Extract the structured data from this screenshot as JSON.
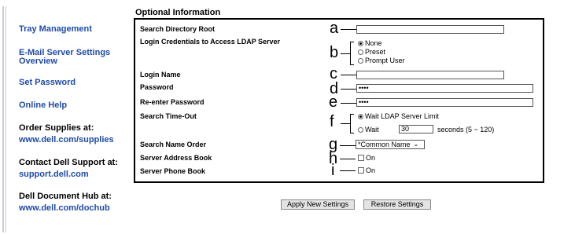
{
  "sidebar": {
    "links": [
      {
        "label": "Tray Management"
      },
      {
        "label": "E-Mail Server Settings Overview"
      },
      {
        "label": "Set Password"
      },
      {
        "label": "Online Help"
      }
    ],
    "order_title": "Order Supplies at:",
    "order_url": "www.dell.com/supplies",
    "support_title": "Contact Dell Support at:",
    "support_url": "support.dell.com",
    "hub_title": "Dell Document Hub at:",
    "hub_url": "www.dell.com/dochub"
  },
  "form": {
    "section_title": "Optional Information",
    "rows": {
      "search_root": "Search Directory Root",
      "login_credentials": "Login Credentials to Access LDAP Server",
      "login_name": "Login Name",
      "password": "Password",
      "reenter_password": "Re-enter Password",
      "timeout": "Search Time-Out",
      "name_order": "Search Name Order",
      "address_book": "Server Address Book",
      "phone_book": "Server Phone Book"
    },
    "credentials_options": [
      "None",
      "Preset",
      "Prompt User"
    ],
    "credentials_selected": "None",
    "password_value": "••••",
    "reenter_value": "••••",
    "timeout_options": [
      "Wait LDAP Server Limit",
      "Wait"
    ],
    "timeout_selected": "Wait LDAP Server Limit",
    "timeout_value": "30",
    "timeout_hint": "seconds (5 ~ 120)",
    "name_order_value": "*Common Name",
    "address_book_label": "On",
    "phone_book_label": "On"
  },
  "callouts": [
    "a",
    "b",
    "c",
    "d",
    "e",
    "f",
    "g",
    "h",
    "i"
  ],
  "buttons": {
    "apply": "Apply New Settings",
    "restore": "Restore Settings"
  }
}
